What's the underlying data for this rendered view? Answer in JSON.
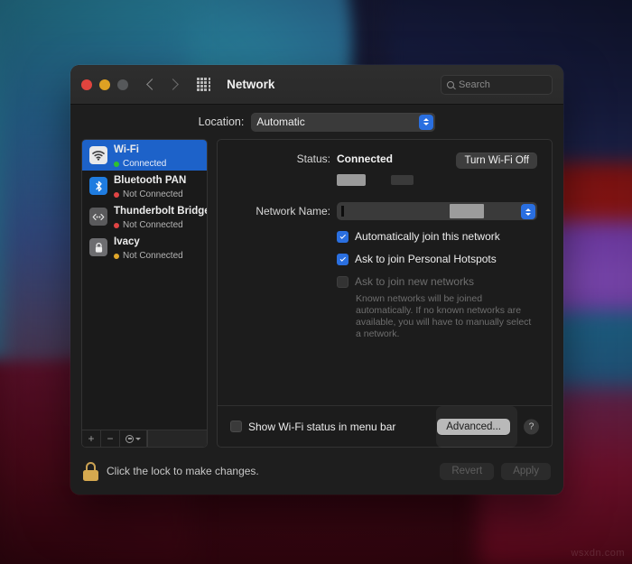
{
  "desktop": {
    "watermark": "wsxdn.com",
    "colors": {
      "teal": "#2b8fa8",
      "navy": "#151833",
      "crimson": "#5c0b22",
      "purple": "#7b3fb8",
      "red_band": "#a01a18"
    }
  },
  "window": {
    "title": "Network",
    "traffic_lights": [
      {
        "name": "close",
        "color": "#e0443e"
      },
      {
        "name": "minimize",
        "color": "#dea123"
      },
      {
        "name": "zoom",
        "color": "#56585a"
      }
    ],
    "nav": {
      "back_icon": "chevron-left-icon",
      "forward_icon": "chevron-right-icon",
      "grid_icon": "show-all-grid-icon"
    },
    "search": {
      "placeholder": "Search",
      "value": "",
      "icon": "search-icon"
    }
  },
  "location": {
    "label": "Location:",
    "value": "Automatic",
    "options": [
      "Automatic"
    ]
  },
  "sidebar": {
    "services": [
      {
        "name": "Wi-Fi",
        "status": "Connected",
        "status_color": "#2fc12f",
        "icon": "wifi-icon",
        "selected": true
      },
      {
        "name": "Bluetooth PAN",
        "status": "Not Connected",
        "status_color": "#e04444",
        "icon": "bluetooth-icon",
        "selected": false
      },
      {
        "name": "Thunderbolt Bridge",
        "status": "Not Connected",
        "status_color": "#e04444",
        "icon": "thunderbolt-icon",
        "selected": false
      },
      {
        "name": "Ivacy",
        "status": "Not Connected",
        "status_color": "#e0a62a",
        "icon": "lock-icon",
        "selected": false
      }
    ],
    "footer": {
      "add_label": "+",
      "remove_label": "−",
      "more_icon": "action-gear-icon"
    }
  },
  "detail": {
    "status_label": "Status:",
    "status_value": "Connected",
    "turn_wifi_off_label": "Turn Wi-Fi Off",
    "network_name_label": "Network Name:",
    "network_name_value": "",
    "checkboxes": [
      {
        "label": "Automatically join this network",
        "checked": true,
        "enabled": true
      },
      {
        "label": "Ask to join Personal Hotspots",
        "checked": true,
        "enabled": true
      },
      {
        "label": "Ask to join new networks",
        "checked": false,
        "enabled": false
      }
    ],
    "hint": "Known networks will be joined automatically. If no known networks are available, you will have to manually select a network.",
    "show_status_label": "Show Wi-Fi status in menu bar",
    "show_status_checked": false,
    "advanced_label": "Advanced...",
    "help_label": "?"
  },
  "footer": {
    "lock_icon": "lock-closed-icon",
    "lock_text": "Click the lock to make changes.",
    "revert_label": "Revert",
    "apply_label": "Apply"
  }
}
